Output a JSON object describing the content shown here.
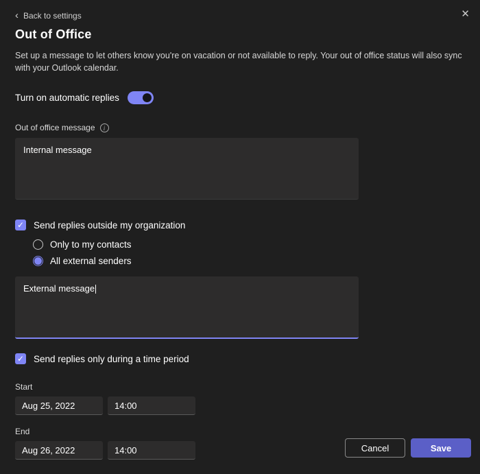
{
  "header": {
    "back_label": "Back to settings",
    "title": "Out of Office",
    "description": "Set up a message to let others know you're on vacation or not available to reply. Your out of office status will also sync with your Outlook calendar."
  },
  "toggle": {
    "label": "Turn on automatic replies",
    "state": "on"
  },
  "internal": {
    "label": "Out of office message",
    "value": "Internal message"
  },
  "external": {
    "checkbox_label": "Send replies outside my organization",
    "checked": true,
    "options": [
      {
        "label": "Only to my contacts",
        "selected": false
      },
      {
        "label": "All external senders",
        "selected": true
      }
    ],
    "value": "External message"
  },
  "time_period": {
    "checkbox_label": "Send replies only during a time period",
    "checked": true,
    "start_label": "Start",
    "start_date": "Aug 25, 2022",
    "start_time": "14:00",
    "end_label": "End",
    "end_date": "Aug 26, 2022",
    "end_time": "14:00"
  },
  "footer": {
    "cancel_label": "Cancel",
    "save_label": "Save"
  },
  "icons": {
    "back_chevron": "‹",
    "close": "✕",
    "info": "i",
    "check": "✓"
  },
  "colors": {
    "accent": "#7f85f5",
    "save_button": "#5b5fc7"
  }
}
